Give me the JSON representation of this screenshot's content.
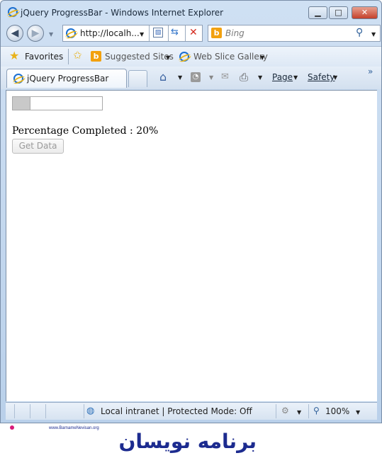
{
  "window": {
    "title": "jQuery ProgressBar - Windows Internet Explorer",
    "buttons": {
      "minimize": "▁",
      "maximize": "□",
      "close": "✕"
    }
  },
  "navbar": {
    "address": "http://localh...",
    "search_placeholder": "Bing"
  },
  "favorites_bar": {
    "favorites_label": "Favorites",
    "items": [
      "Suggested Sites",
      "Web Slice Gallery"
    ]
  },
  "tabs": {
    "active_tab_label": "jQuery ProgressBar",
    "chevron": "»"
  },
  "command_bar": {
    "page_label": "Page",
    "safety_label": "Safety"
  },
  "page": {
    "progress_fraction": 0.2,
    "percentage_text": "Percentage Completed : 20%",
    "button_label": "Get Data"
  },
  "status_bar": {
    "zone_text": "Local intranet | Protected Mode: Off",
    "zoom": "100%"
  },
  "watermark": {
    "url_text": "www.BarnameNevisan.org",
    "logo_text": "برنامه نویسان"
  },
  "colors": {
    "frame": "#cfe0f3",
    "progress_fill": "#c9c9c9",
    "close_button": "#c4402b"
  }
}
